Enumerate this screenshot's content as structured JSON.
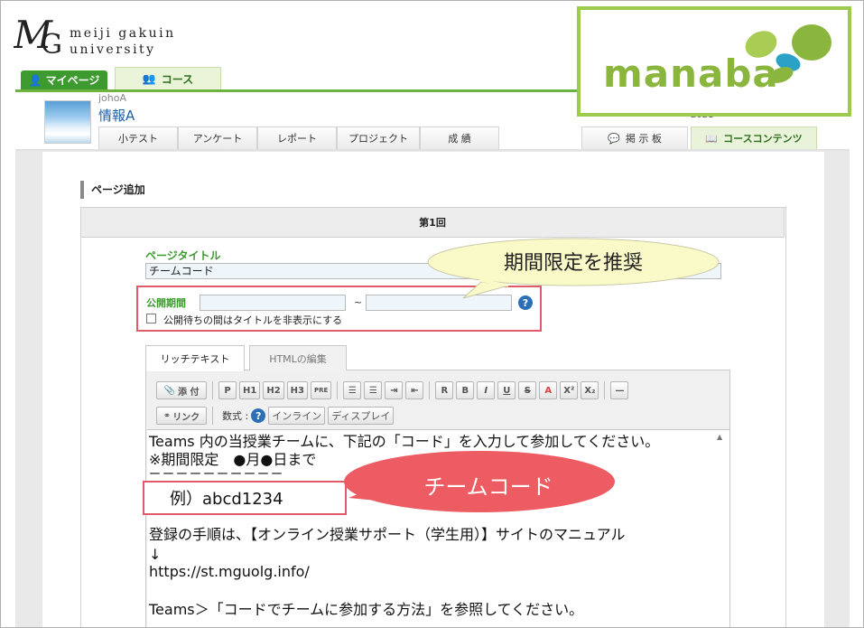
{
  "university": {
    "line1": "meiji gakuin",
    "line2": "university"
  },
  "topnav": {
    "mypage": "マイページ",
    "course": "コース"
  },
  "course": {
    "code": "johoA",
    "title": "情報A",
    "year": "2021"
  },
  "subtabs": [
    "小テスト",
    "アンケート",
    "レポート",
    "プロジェクト",
    "成 績"
  ],
  "right_tabs": {
    "board": "掲 示 板",
    "content": "コースコンテンツ"
  },
  "page_heading": "ページ追加",
  "round_title": "第1回",
  "form": {
    "page_title_label": "ページタイトル",
    "page_title_value": "チームコード",
    "publish_label": "公開期間",
    "tilde": "~",
    "help": "?",
    "hide_title_label": "公開待ちの間はタイトルを非表示にする"
  },
  "editor": {
    "tab_rich": "リッチテキスト",
    "tab_html": "HTMLの編集",
    "toolbar": {
      "attach": "添 付",
      "p": "P",
      "h1": "H1",
      "h2": "H2",
      "h3": "H3",
      "pre": "PRE",
      "r": "R",
      "b": "B",
      "i": "I",
      "u": "U",
      "s": "S",
      "a": "A",
      "sup": "X²",
      "sub": "X₂",
      "hr": "—",
      "link": "リンク",
      "formula_label": "数式 :",
      "inline": "インライン",
      "display": "ディスプレイ"
    },
    "lines": {
      "l1": "Teams 内の当授業チームに、下記の「コード」を入力して参加してください。",
      "l2": "※期間限定　●月●日まで",
      "l3": "ーーーーーーーーーー",
      "l4": "ーーーーーーーーーー",
      "l5": "登録の手順は、【オンライン授業サポート（学生用）】サイトのマニュアル",
      "l6": "↓",
      "l7": "https://st.mguolg.info/",
      "l8": "Teams＞「コードでチームに参加する方法」を参照してください。"
    },
    "example": "例）abcd1234"
  },
  "callouts": {
    "recommend": "期間限定を推奨",
    "team_code": "チームコード"
  },
  "manaba": "manaba",
  "colors": {
    "green": "#3d9a2f",
    "red_highlight": "#e05a6a",
    "yellow_callout": "#fafac8",
    "red_callout": "#ee5c63",
    "manaba_green": "#8ab63d"
  }
}
